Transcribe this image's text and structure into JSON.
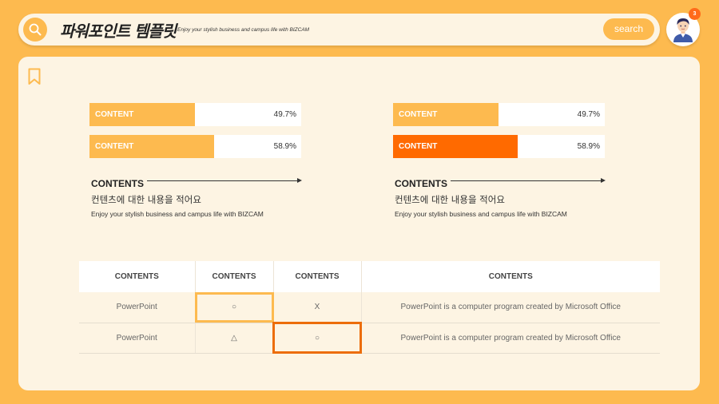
{
  "header": {
    "title": "파워포인트 템플릿",
    "subtitle": "Enjoy your stylish business and campus life with BIZCAM",
    "search_label": "search",
    "notification_count": "3"
  },
  "bars": {
    "left": [
      {
        "label": "CONTENT",
        "value_text": "49.7%",
        "fill": 0.497,
        "color": "#FDBA4F"
      },
      {
        "label": "CONTENT",
        "value_text": "58.9%",
        "fill": 0.589,
        "color": "#FDBA4F"
      }
    ],
    "right": [
      {
        "label": "CONTENT",
        "value_text": "49.7%",
        "fill": 0.497,
        "color": "#FDBA4F"
      },
      {
        "label": "CONTENT",
        "value_text": "58.9%",
        "fill": 0.589,
        "color": "#FF6A00"
      }
    ]
  },
  "blocks": {
    "left": {
      "heading": "CONTENTS",
      "korean": "컨텐츠에 대한 내용을 적어요",
      "english": "Enjoy your stylish business and campus life with BIZCAM"
    },
    "right": {
      "heading": "CONTENTS",
      "korean": "컨텐츠에 대한 내용을 적어요",
      "english": "Enjoy your stylish business and campus life with BIZCAM"
    }
  },
  "table": {
    "headers": [
      "CONTENTS",
      "CONTENTS",
      "CONTENTS",
      "CONTENTS"
    ],
    "rows": [
      [
        "PowerPoint",
        "○",
        "X",
        "PowerPoint is a computer program created by Microsoft Office"
      ],
      [
        "PowerPoint",
        "△",
        "○",
        "PowerPoint is a computer program created by Microsoft Office"
      ]
    ]
  },
  "colors": {
    "background": "#FDBA4F",
    "card": "#FDF4E3",
    "accent_light": "#FDBA4F",
    "accent_dark": "#FF6A00"
  },
  "icons": {
    "search": "search-icon",
    "avatar": "user-avatar-icon",
    "bookmark": "bookmark-icon"
  }
}
